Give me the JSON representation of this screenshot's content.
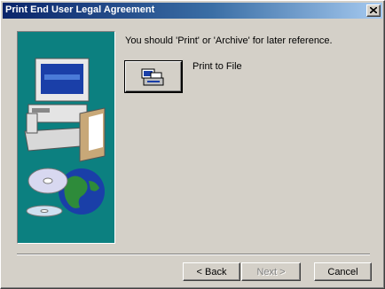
{
  "window": {
    "title": "Print End User Legal Agreement"
  },
  "content": {
    "instruction": "You should 'Print' or 'Archive' for later reference.",
    "print_to_file_label": "Print to File"
  },
  "buttons": {
    "back_label": "< Back",
    "next_label": "Next >",
    "cancel_label": "Cancel"
  },
  "colors": {
    "titlebar_start": "#0a246a",
    "titlebar_end": "#a6caf0",
    "side_panel": "#0c8080",
    "face": "#d4d0c8"
  },
  "icons": {
    "close": "close-icon",
    "print": "printer-icon",
    "side": "computer-globe-cd-illustration"
  }
}
